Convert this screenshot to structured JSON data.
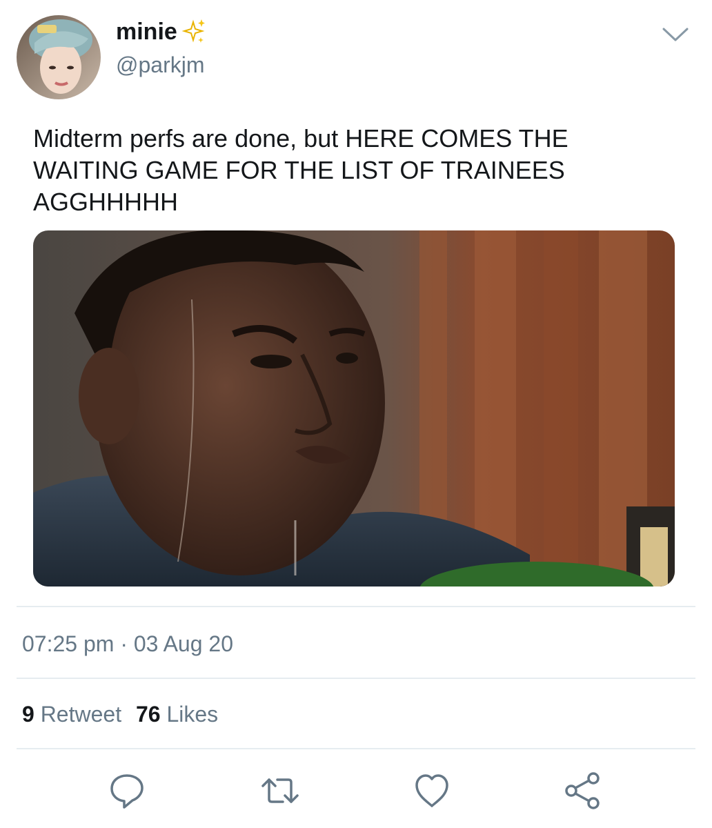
{
  "user": {
    "display_name": "minie",
    "handle": "@parkjm"
  },
  "tweet": {
    "text": "Midterm perfs are done, but HERE COMES THE\nWAITING GAME FOR THE LIST OF TRAINEES\nAGGHHHHH",
    "time": "07:25 pm",
    "separator": "·",
    "date": "03 Aug 20"
  },
  "stats": {
    "retweet_count": "9",
    "retweet_label": "Retweet",
    "likes_count": "76",
    "likes_label": "Likes"
  },
  "icons": {
    "name_badge": "sparkles-icon",
    "menu": "chevron-down-icon",
    "actions": [
      "reply-icon",
      "retweet-icon",
      "like-icon",
      "share-icon"
    ]
  },
  "colors": {
    "text_primary": "#14171a",
    "text_secondary": "#657786",
    "divider": "#e6ecf0",
    "sparkle": "#f5c518"
  }
}
